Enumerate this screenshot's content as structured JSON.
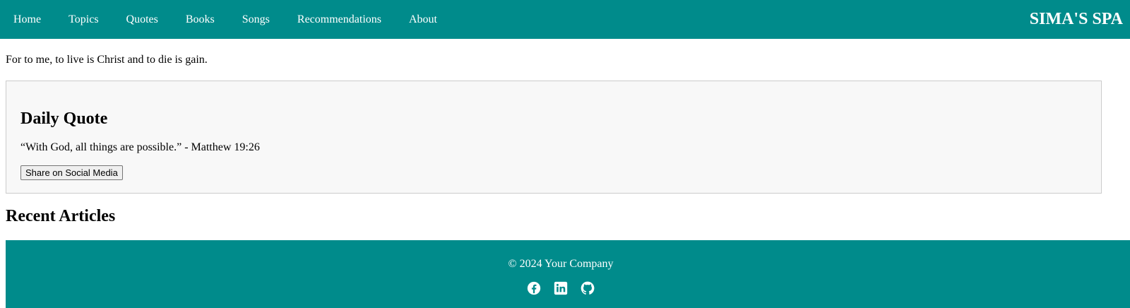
{
  "nav": {
    "links": [
      {
        "label": "Home"
      },
      {
        "label": "Topics"
      },
      {
        "label": "Quotes"
      },
      {
        "label": "Books"
      },
      {
        "label": "Songs"
      },
      {
        "label": "Recommendations"
      },
      {
        "label": "About"
      }
    ],
    "brand": "SIMA'S SPA"
  },
  "main": {
    "intro": "For to me, to live is Christ and to die is gain.",
    "daily_quote": {
      "title": "Daily Quote",
      "text": "“With God, all things are possible.” - Matthew 19:26",
      "share_label": "Share on Social Media"
    },
    "recent_articles_title": "Recent Articles"
  },
  "footer": {
    "copyright": "© 2024 Your Company",
    "social_icons": [
      "facebook-icon",
      "linkedin-icon",
      "github-icon"
    ]
  },
  "colors": {
    "accent": "#008b8b",
    "card_background": "#f8f8f8",
    "card_border": "#cccccc",
    "text_on_accent": "#ffffff"
  }
}
